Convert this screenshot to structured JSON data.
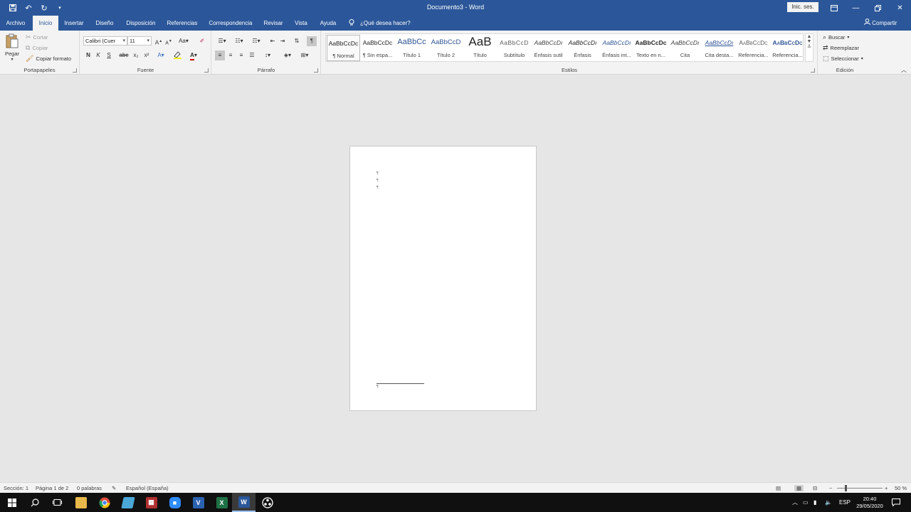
{
  "titlebar": {
    "document_title": "Documento3 - Word",
    "signin_label": "Inic. ses.",
    "qat": [
      "save-icon",
      "undo-icon",
      "redo-icon",
      "customize-qat-icon"
    ]
  },
  "tabs": [
    {
      "label": "Archivo"
    },
    {
      "label": "Inicio"
    },
    {
      "label": "Insertar"
    },
    {
      "label": "Diseño"
    },
    {
      "label": "Disposición"
    },
    {
      "label": "Referencias"
    },
    {
      "label": "Correspondencia"
    },
    {
      "label": "Revisar"
    },
    {
      "label": "Vista"
    },
    {
      "label": "Ayuda"
    }
  ],
  "tell_me": "¿Qué desea hacer?",
  "share_label": "Compartir",
  "clipboard": {
    "paste_label": "Pegar",
    "cut_label": "Cortar",
    "copy_label": "Copiar",
    "format_painter_label": "Copiar formato",
    "group_label": "Portapapeles"
  },
  "font": {
    "font_name": "Calibri (Cuer",
    "font_size": "11",
    "bold": "N",
    "italic": "K",
    "underline": "S",
    "strike": "abc",
    "subscript": "x₂",
    "superscript": "x²",
    "case": "Aa",
    "grow": "A",
    "shrink": "A",
    "group_label": "Fuente"
  },
  "paragraph": {
    "pilcrow": "¶",
    "group_label": "Párrafo"
  },
  "styles": {
    "items": [
      {
        "sample": "AaBbCcDc",
        "name": "¶ Normal"
      },
      {
        "sample": "AaBbCcDc",
        "name": "¶ Sin espa..."
      },
      {
        "sample": "AaBbCc",
        "name": "Título 1"
      },
      {
        "sample": "AaBbCcD",
        "name": "Título 2"
      },
      {
        "sample": "AaB",
        "name": "Título"
      },
      {
        "sample": "AaBbCcD",
        "name": "Subtítulo"
      },
      {
        "sample": "AaBbCcDı",
        "name": "Énfasis sutil"
      },
      {
        "sample": "AaBbCcDı",
        "name": "Énfasis"
      },
      {
        "sample": "AaBbCcDı",
        "name": "Énfasis int..."
      },
      {
        "sample": "AaBbCcDc",
        "name": "Texto en n..."
      },
      {
        "sample": "AaBbCcDı",
        "name": "Cita"
      },
      {
        "sample": "AaBbCcDı",
        "name": "Cita desta..."
      },
      {
        "sample": "AaBbCcDc",
        "name": "Referencia..."
      },
      {
        "sample": "AaBbCcDc",
        "name": "Referencia..."
      }
    ],
    "group_label": "Estilos"
  },
  "editing": {
    "find_label": "Buscar",
    "replace_label": "Reemplazar",
    "select_label": "Seleccionar",
    "group_label": "Edición"
  },
  "statusbar": {
    "section": "Sección: 1",
    "page": "Página 1 de 2",
    "words": "0 palabras",
    "language": "Español (España)",
    "zoom_minus": "−",
    "zoom_plus": "+",
    "zoom": "50 %",
    "zoom_level": 0.2
  },
  "taskbar": {
    "lang": "ESP",
    "time": "20:40",
    "date": "29/05/2020"
  },
  "colors": {
    "brand": "#2b579a",
    "excel": "#1e7145",
    "word": "#2b579a",
    "chrome": "#dd4b39"
  }
}
